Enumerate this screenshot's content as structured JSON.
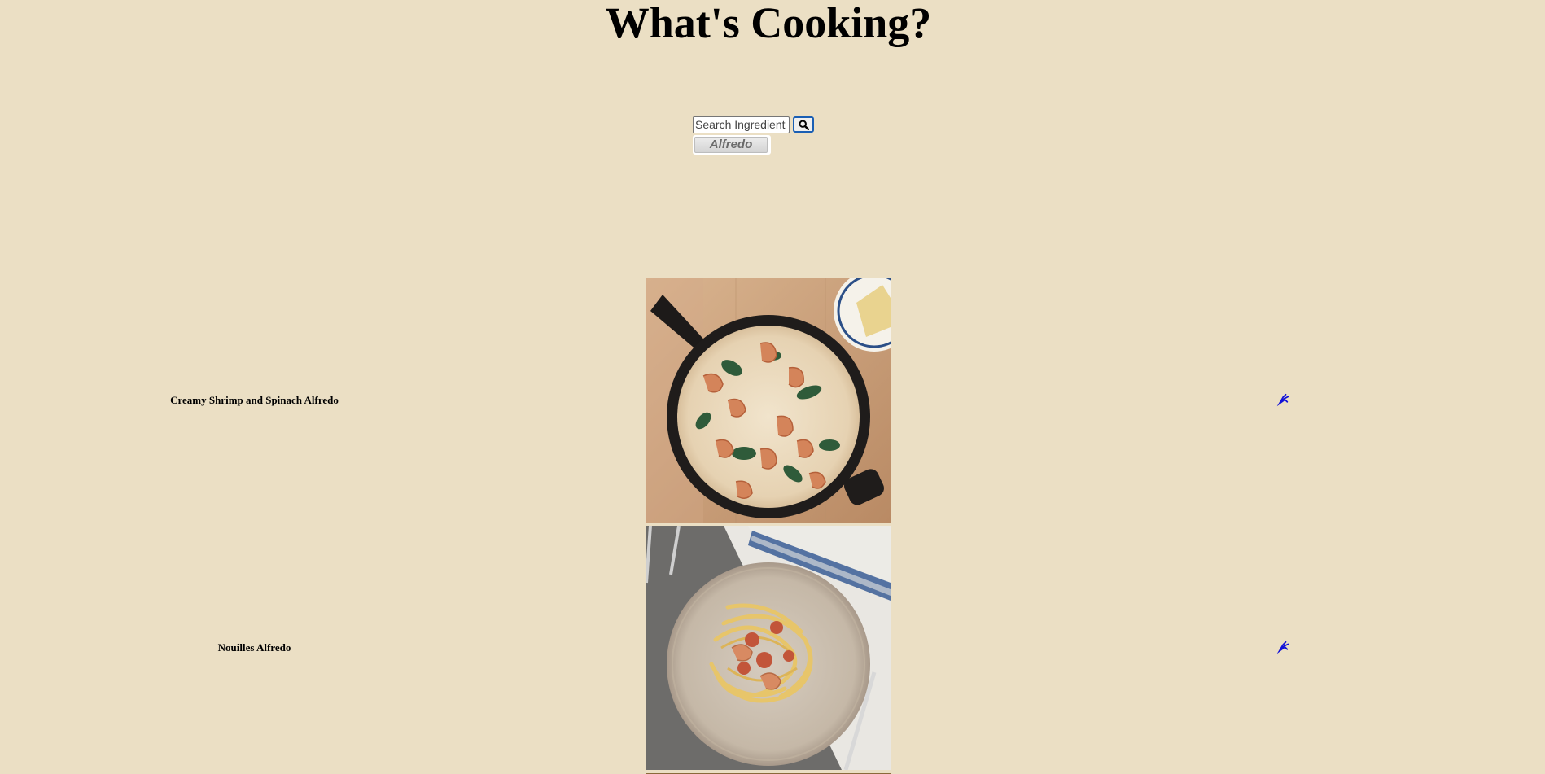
{
  "header": {
    "title": "What's Cooking?"
  },
  "search": {
    "placeholder": "Search Ingredient",
    "button_icon": "search-icon"
  },
  "filter_chips": [
    {
      "label": "Alfredo"
    }
  ],
  "recipes": [
    {
      "name": "Creamy Shrimp and Spinach Alfredo",
      "image": "shrimp-spinach-alfredo-skillet",
      "action_icon": "carrot-icon"
    },
    {
      "name": "Nouilles Alfredo",
      "image": "alfredo-noodles-plate",
      "action_icon": "carrot-icon"
    }
  ],
  "colors": {
    "background": "#ebdfc4",
    "icon_blue": "#1212d8",
    "search_focus": "#1a5fb4"
  }
}
